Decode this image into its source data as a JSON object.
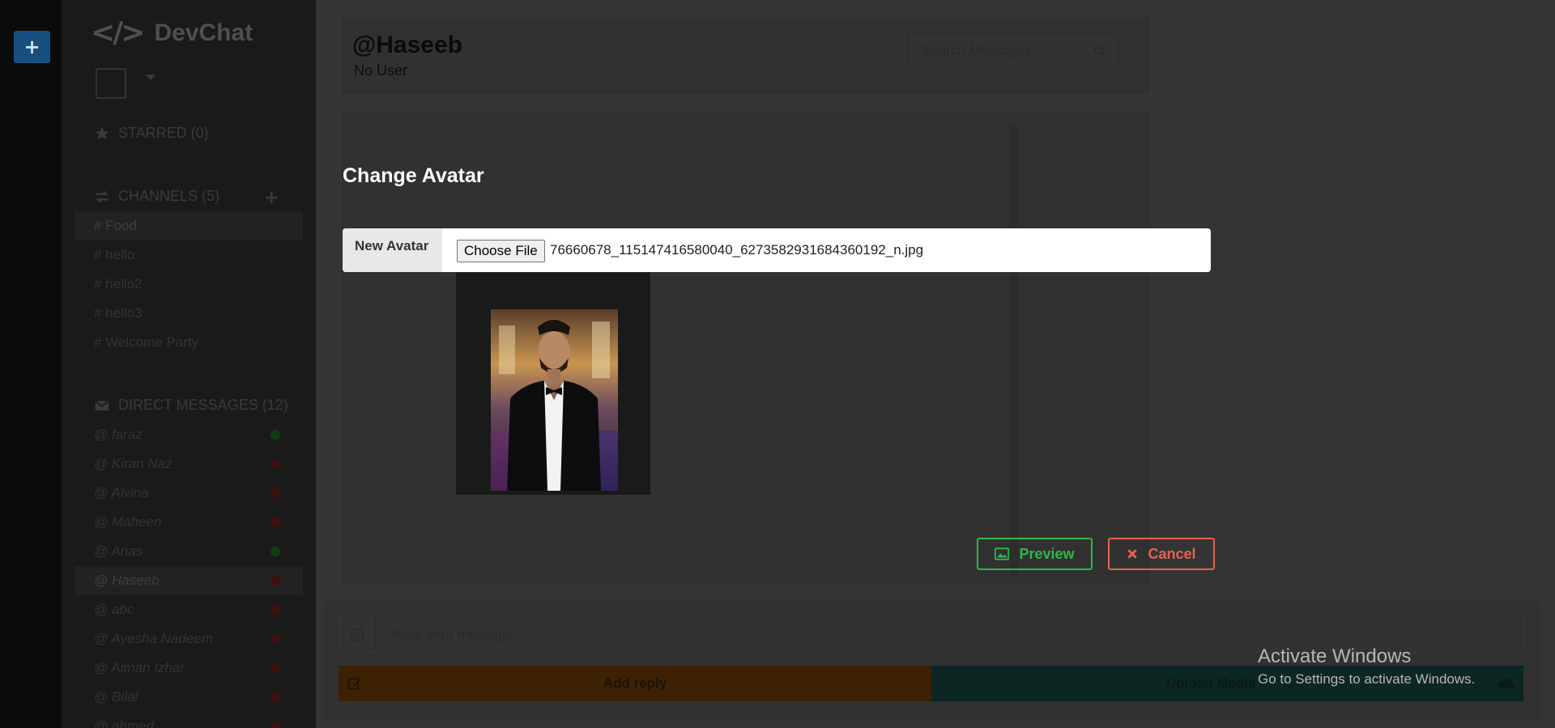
{
  "sidebar": {
    "brand": "DevChat",
    "starred_label": "STARRED (0)",
    "channels_label": "CHANNELS (5)",
    "channels": [
      "# Food",
      "# hello",
      "# hello2",
      "# hello3",
      "# Welcome Party"
    ],
    "dm_label": "DIRECT MESSAGES (12)",
    "dms": [
      {
        "name": "@ faraz",
        "status": "online"
      },
      {
        "name": "@ Kiran Naz",
        "status": "offline"
      },
      {
        "name": "@ Alvina",
        "status": "offline"
      },
      {
        "name": "@ Maheen",
        "status": "offline"
      },
      {
        "name": "@ Anas",
        "status": "online"
      },
      {
        "name": "@ Haseeb",
        "status": "offline"
      },
      {
        "name": "@ abc",
        "status": "offline"
      },
      {
        "name": "@ Ayesha Nadeem",
        "status": "offline"
      },
      {
        "name": "@ Aiman Izhar",
        "status": "offline"
      },
      {
        "name": "@ Bilal",
        "status": "offline"
      },
      {
        "name": "@ ahmed",
        "status": "offline"
      }
    ]
  },
  "header": {
    "title": "@Haseeb",
    "subtitle": "No User",
    "search_placeholder": "Search Messages"
  },
  "composer": {
    "placeholder": "Write your message",
    "reply_label": "Add reply",
    "upload_label": "Upload Media"
  },
  "modal": {
    "title": "Change Avatar",
    "field_label": "New Avatar",
    "choose_button": "Choose File",
    "file_name": "76660678_115147416580040_6273582931684360192_n.jpg",
    "preview_button": "Preview",
    "cancel_button": "Cancel"
  },
  "watermark": {
    "title": "Activate Windows",
    "subtitle": "Go to Settings to activate Windows."
  },
  "colors": {
    "preview": "#2fb64a",
    "cancel": "#e5624e",
    "reply": "#3d2103",
    "upload": "#0c2624"
  }
}
